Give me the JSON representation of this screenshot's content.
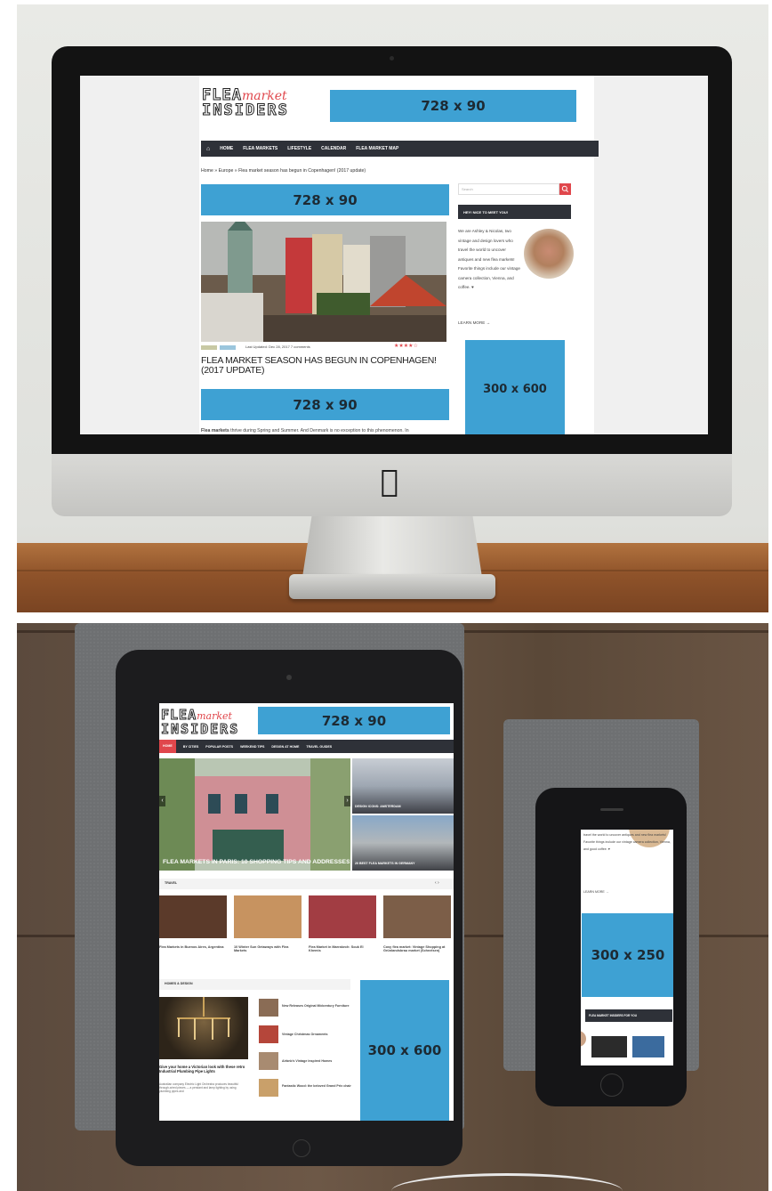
{
  "site": {
    "logo_word1": "FLEA",
    "logo_word2": "market",
    "logo_word3": "INSIDERS"
  },
  "desktop": {
    "ad_header": "728 x 90",
    "nav": [
      "HOME",
      "FLEA MARKETS",
      "LIFESTYLE",
      "CALENDAR",
      "FLEA MARKET MAP"
    ],
    "breadcrumb": "Home » Europe » Flea market season has begun in Copenhagen! (2017 update)",
    "ad_in_content_1": "728 x 90",
    "post_meta": "Last Updated: Dec 28, 2017   7 comments",
    "rating": "★★★★☆",
    "post_title": "FLEA MARKET SEASON HAS BEGUN IN COPENHAGEN! (2017 UPDATE)",
    "ad_in_content_2": "728 x 90",
    "intro_bold": "Flea markets",
    "intro_rest": " thrive during Spring and Summer. And Denmark is no exception to this phenomenon. In",
    "search_placeholder": "Search",
    "search_icon": "magnifier-icon",
    "sidebar_title": "HEY! NICE TO MEET YOU!",
    "about_text": "We are Ashley & Nicolas, two vintage and design lovers who travel the world to uncover antiques and new flea markets! Favorite things include our vintage camera collection, Vienna, and coffee. ♥",
    "learn_more": "LEARN MORE →",
    "ad_sidebar": "300 x 600"
  },
  "tablet": {
    "ad_header": "728 x 90",
    "nav": [
      "HOME",
      "BY CITIES",
      "POPULAR POSTS",
      "WEEKEND TIPS",
      "DESIGN AT HOME",
      "TRAVEL GUIDES"
    ],
    "hero_title": "FLEA MARKETS IN PARIS: 10 SHOPPING TIPS AND ADDRESSES",
    "side_card_1": "DESIGN ICONS: AMSTERDAM",
    "side_card_2": "20 BEST FLEA MARKETS IN GERMANY",
    "travel_label": "TRAVEL",
    "travel_posts": [
      "Flea Markets in Buenos Aires, Argentina",
      "10 Winter Sun Getaways with Flea Markets",
      "Flea Market in Marrakech: Souk El Khemis",
      "Cosy flea market: Vintage Shopping at Grünlandsbrau market (Schnelsen)"
    ],
    "homes_label": "HOMES & DESIGN",
    "feature_title": "Give your home a Victorian look with these retro Industrial Plumbing Pipe Lights",
    "feature_excerpt": "Australian company Electric Light Orchestra produces beautiful through-wired pieces — a pendant and lamp lighting by using plumbing pipes and",
    "list_posts": [
      "New Releases Original Midcentury Furniture",
      "Vintage Christmas Ornaments",
      "Airbnb's Vintage Inspired Homes",
      "Fantastic Wood: the beloved Grand Prix chair"
    ],
    "ad_sidebar": "300 x 600"
  },
  "phone": {
    "about_partial": "travel the world to uncover antiques and new flea markets! Favorite things include our vintage camera collection, Vienna, and good coffee. ♥",
    "learn_more": "LEARN MORE →",
    "ad": "300 x 250",
    "widget_title": "FLEA MARKET INSIDERS FOR YOU"
  },
  "colors": {
    "ad_blue": "#3ea1d3",
    "nav_dark": "#2e3138",
    "accent_red": "#e0474c"
  }
}
